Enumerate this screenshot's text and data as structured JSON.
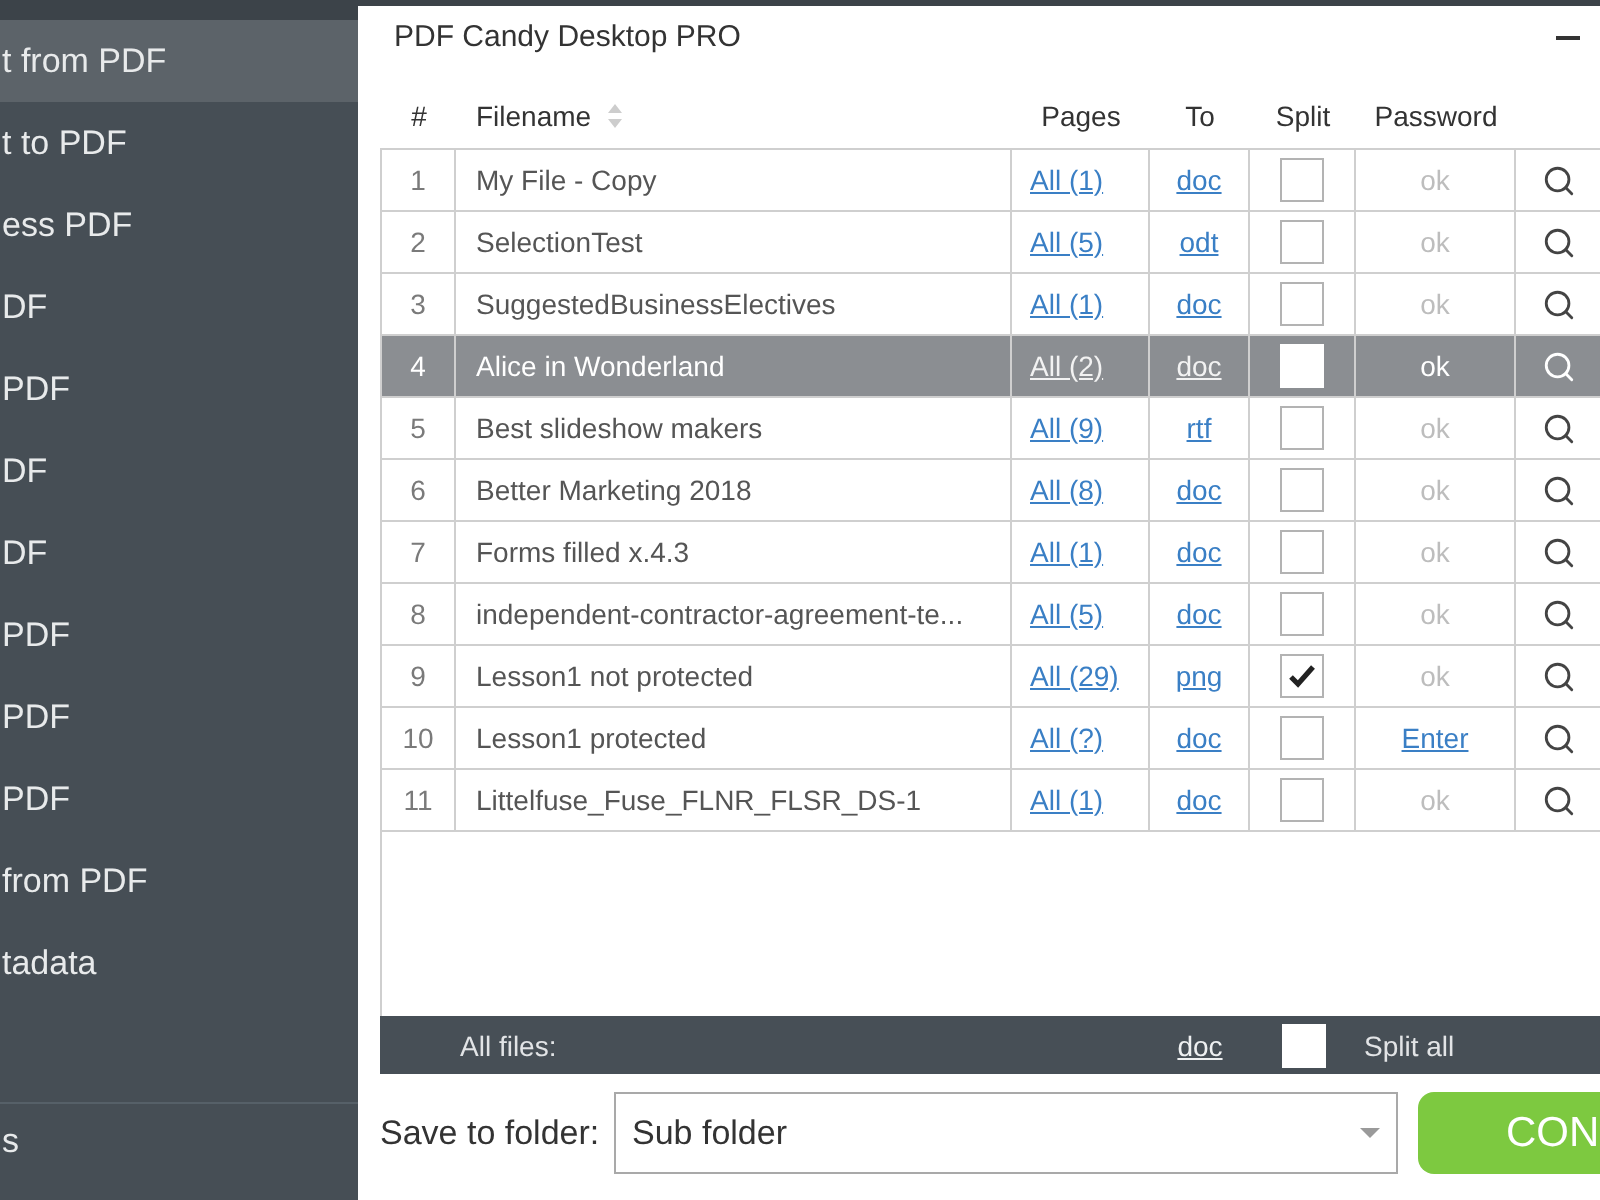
{
  "window": {
    "title": "PDF Candy Desktop PRO"
  },
  "sidebar": {
    "items": [
      {
        "label": "t from PDF",
        "selected": true
      },
      {
        "label": "t to PDF",
        "selected": false
      },
      {
        "label": "ess PDF",
        "selected": false
      },
      {
        "label": "DF",
        "selected": false
      },
      {
        "label": "PDF",
        "selected": false
      },
      {
        "label": "DF",
        "selected": false
      },
      {
        "label": "DF",
        "selected": false
      },
      {
        "label": "PDF",
        "selected": false
      },
      {
        "label": "PDF",
        "selected": false
      },
      {
        "label": "PDF",
        "selected": false
      },
      {
        "label": "from PDF",
        "selected": false
      },
      {
        "label": "tadata",
        "selected": false
      }
    ],
    "bottom_item": {
      "label": "s"
    }
  },
  "table": {
    "columns": [
      {
        "label": "#",
        "sortable": false
      },
      {
        "label": "Filename",
        "sortable": true
      },
      {
        "label": "Pages",
        "sortable": false
      },
      {
        "label": "To",
        "sortable": false
      },
      {
        "label": "Split",
        "sortable": false
      },
      {
        "label": "Password",
        "sortable": false
      }
    ],
    "rows": [
      {
        "number": "1",
        "filename": "My File - Copy",
        "pages": "All (1)",
        "format": "doc",
        "split": false,
        "password": {
          "kind": "status",
          "text": "ok"
        },
        "selected": false
      },
      {
        "number": "2",
        "filename": "SelectionTest",
        "pages": "All (5)",
        "format": "odt",
        "split": false,
        "password": {
          "kind": "status",
          "text": "ok"
        },
        "selected": false
      },
      {
        "number": "3",
        "filename": "SuggestedBusinessElectives",
        "pages": "All (1)",
        "format": "doc",
        "split": false,
        "password": {
          "kind": "status",
          "text": "ok"
        },
        "selected": false
      },
      {
        "number": "4",
        "filename": "Alice in Wonderland",
        "pages": "All (2)",
        "format": "doc",
        "split": false,
        "password": {
          "kind": "status",
          "text": "ok"
        },
        "selected": true
      },
      {
        "number": "5",
        "filename": "Best slideshow makers",
        "pages": "All (9)",
        "format": "rtf",
        "split": false,
        "password": {
          "kind": "status",
          "text": "ok"
        },
        "selected": false
      },
      {
        "number": "6",
        "filename": "Better Marketing 2018",
        "pages": "All (8)",
        "format": "doc",
        "split": false,
        "password": {
          "kind": "status",
          "text": "ok"
        },
        "selected": false
      },
      {
        "number": "7",
        "filename": "Forms filled x.4.3",
        "pages": "All (1)",
        "format": "doc",
        "split": false,
        "password": {
          "kind": "status",
          "text": "ok"
        },
        "selected": false
      },
      {
        "number": "8",
        "filename": "independent-contractor-agreement-te...",
        "pages": "All (5)",
        "format": "doc",
        "split": false,
        "password": {
          "kind": "status",
          "text": "ok"
        },
        "selected": false
      },
      {
        "number": "9",
        "filename": "Lesson1 not protected",
        "pages": "All (29)",
        "format": "png",
        "split": true,
        "password": {
          "kind": "status",
          "text": "ok"
        },
        "selected": false
      },
      {
        "number": "10",
        "filename": "Lesson1 protected",
        "pages": "All (?)",
        "format": "doc",
        "split": false,
        "password": {
          "kind": "link",
          "text": "Enter"
        },
        "selected": false
      },
      {
        "number": "11",
        "filename": "Littelfuse_Fuse_FLNR_FLSR_DS-1",
        "pages": "All (1)",
        "format": "doc",
        "split": false,
        "password": {
          "kind": "status",
          "text": "ok"
        },
        "selected": false
      }
    ]
  },
  "footer": {
    "label": "All files:",
    "format": "doc",
    "split_all": {
      "label": "Split all",
      "checked": false
    }
  },
  "save": {
    "label": "Save to folder:",
    "value": "Sub folder"
  },
  "convert_button": {
    "label": "CON"
  }
}
